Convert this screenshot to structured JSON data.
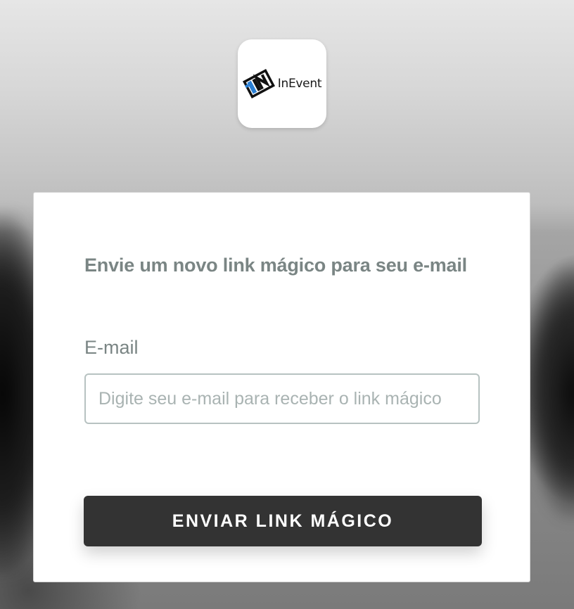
{
  "brand": {
    "logo_text": "InEvent",
    "accent_colors": [
      "#2a7fd4",
      "#111111"
    ]
  },
  "form": {
    "title": "Envie um novo link mágico para seu e-mail",
    "email_label": "E-mail",
    "email_value": "",
    "email_placeholder": "Digite seu e-mail para receber o link mágico",
    "submit_label": "ENVIAR LINK MÁGICO"
  },
  "colors": {
    "button_bg": "#333333",
    "text_muted": "#7a8584",
    "input_border": "#b7c2c1",
    "card_bg": "#ffffff"
  }
}
